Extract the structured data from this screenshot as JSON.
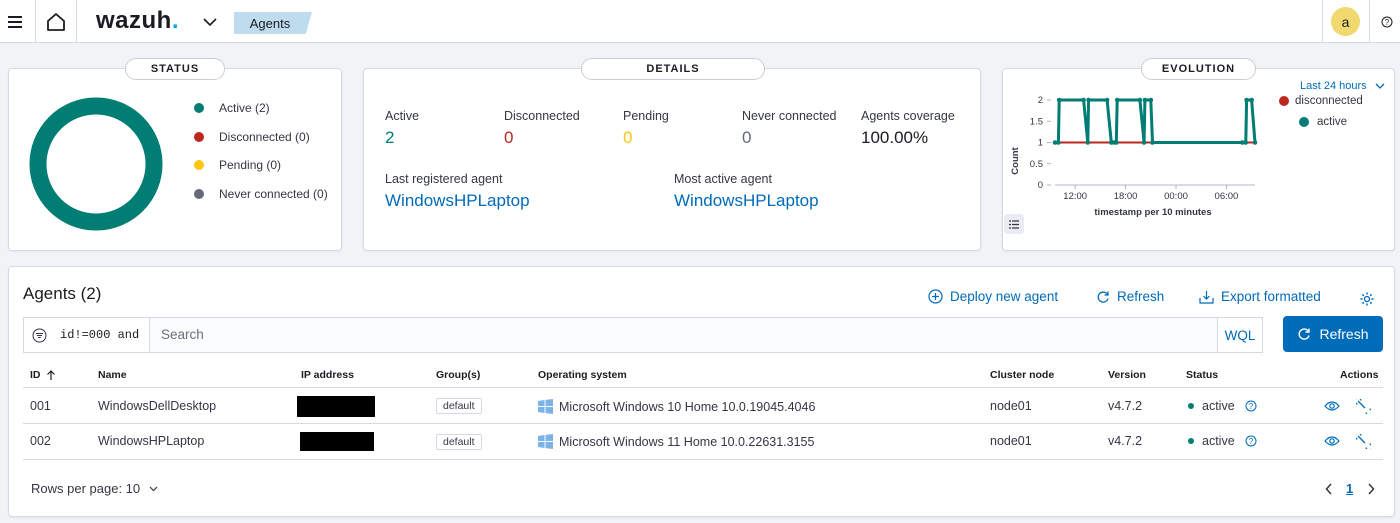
{
  "header": {
    "logo_text": "wazuh",
    "logo_dot": ".",
    "breadcrumb": "Agents",
    "avatar_initial": "a"
  },
  "status_panel": {
    "title": "STATUS",
    "legend": [
      {
        "label": "Active (2)",
        "color": "#017d73"
      },
      {
        "label": "Disconnected (0)",
        "color": "#bd271e"
      },
      {
        "label": "Pending (0)",
        "color": "#fec514"
      },
      {
        "label": "Never connected (0)",
        "color": "#646a77"
      }
    ],
    "donut_color": "#017d73"
  },
  "details_panel": {
    "title": "DETAILS",
    "stats": [
      {
        "label": "Active",
        "value": "2",
        "color": "#017d73"
      },
      {
        "label": "Disconnected",
        "value": "0",
        "color": "#bd271e"
      },
      {
        "label": "Pending",
        "value": "0",
        "color": "#fec514"
      },
      {
        "label": "Never connected",
        "value": "0",
        "color": "#646a77"
      },
      {
        "label": "Agents coverage",
        "value": "100.00%",
        "color": "#1a1c21"
      }
    ],
    "last_registered_label": "Last registered agent",
    "last_registered_value": "WindowsHPLaptop",
    "most_active_label": "Most active agent",
    "most_active_value": "WindowsHPLaptop"
  },
  "evolution_panel": {
    "title": "EVOLUTION",
    "range_label": "Last 24 hours",
    "legend": [
      {
        "label": "disconnected",
        "color": "#bd271e"
      },
      {
        "label": "active",
        "color": "#017d73"
      }
    ],
    "ylabel": "Count",
    "xlabel": "timestamp per 10 minutes",
    "yticks": [
      "2",
      "1.5",
      "1",
      "0.5",
      "0"
    ],
    "xticks": [
      "12:00",
      "18:00",
      "00:00",
      "06:00"
    ]
  },
  "chart_data": {
    "type": "line",
    "title": "",
    "xlabel": "timestamp per 10 minutes",
    "ylabel": "Count",
    "ylim": [
      0,
      2
    ],
    "x_domain_hours": [
      9.6,
      33.4
    ],
    "x_ticks": [
      {
        "label": "12:00",
        "hours": 12
      },
      {
        "label": "18:00",
        "hours": 18
      },
      {
        "label": "00:00",
        "hours": 24
      },
      {
        "label": "06:00",
        "hours": 30
      }
    ],
    "series": [
      {
        "name": "disconnected",
        "color": "#bd271e",
        "x_hours": [
          9.6,
          33.4
        ],
        "values": [
          1,
          1
        ]
      },
      {
        "name": "active",
        "color": "#017d73",
        "x_hours": [
          9.6,
          10.0,
          10.1,
          13.0,
          13.5,
          13.6,
          15.8,
          16.3,
          16.6,
          16.9,
          17.0,
          19.7,
          20.2,
          20.3,
          21.0,
          21.2,
          31.9,
          32.3,
          32.4,
          33.0,
          33.4
        ],
        "values": [
          1,
          1,
          2,
          2,
          1,
          2,
          2,
          1,
          1,
          1,
          2,
          2,
          1,
          2,
          2,
          1,
          1,
          1,
          2,
          2,
          1
        ]
      }
    ]
  },
  "agents": {
    "title": "Agents (2)",
    "deploy_label": "Deploy new agent",
    "refresh_label": "Refresh",
    "export_label": "Export formatted",
    "search_filter": "id!=000 and",
    "search_placeholder": "Search",
    "wql_label": "WQL",
    "refresh_button": "Refresh",
    "columns": {
      "id": "ID",
      "name": "Name",
      "ip": "IP address",
      "groups": "Group(s)",
      "os": "Operating system",
      "cluster": "Cluster node",
      "version": "Version",
      "status": "Status",
      "actions": "Actions"
    },
    "rows": [
      {
        "id": "001",
        "name": "WindowsDellDesktop",
        "group": "default",
        "os": "Microsoft Windows 10 Home 10.0.19045.4046",
        "cluster": "node01",
        "version": "v4.7.2",
        "status": "active"
      },
      {
        "id": "002",
        "name": "WindowsHPLaptop",
        "group": "default",
        "os": "Microsoft Windows 11 Home 10.0.22631.3155",
        "cluster": "node01",
        "version": "v4.7.2",
        "status": "active"
      }
    ],
    "rows_per_page": "Rows per page: 10",
    "current_page": "1",
    "status_color": "#017d73"
  }
}
